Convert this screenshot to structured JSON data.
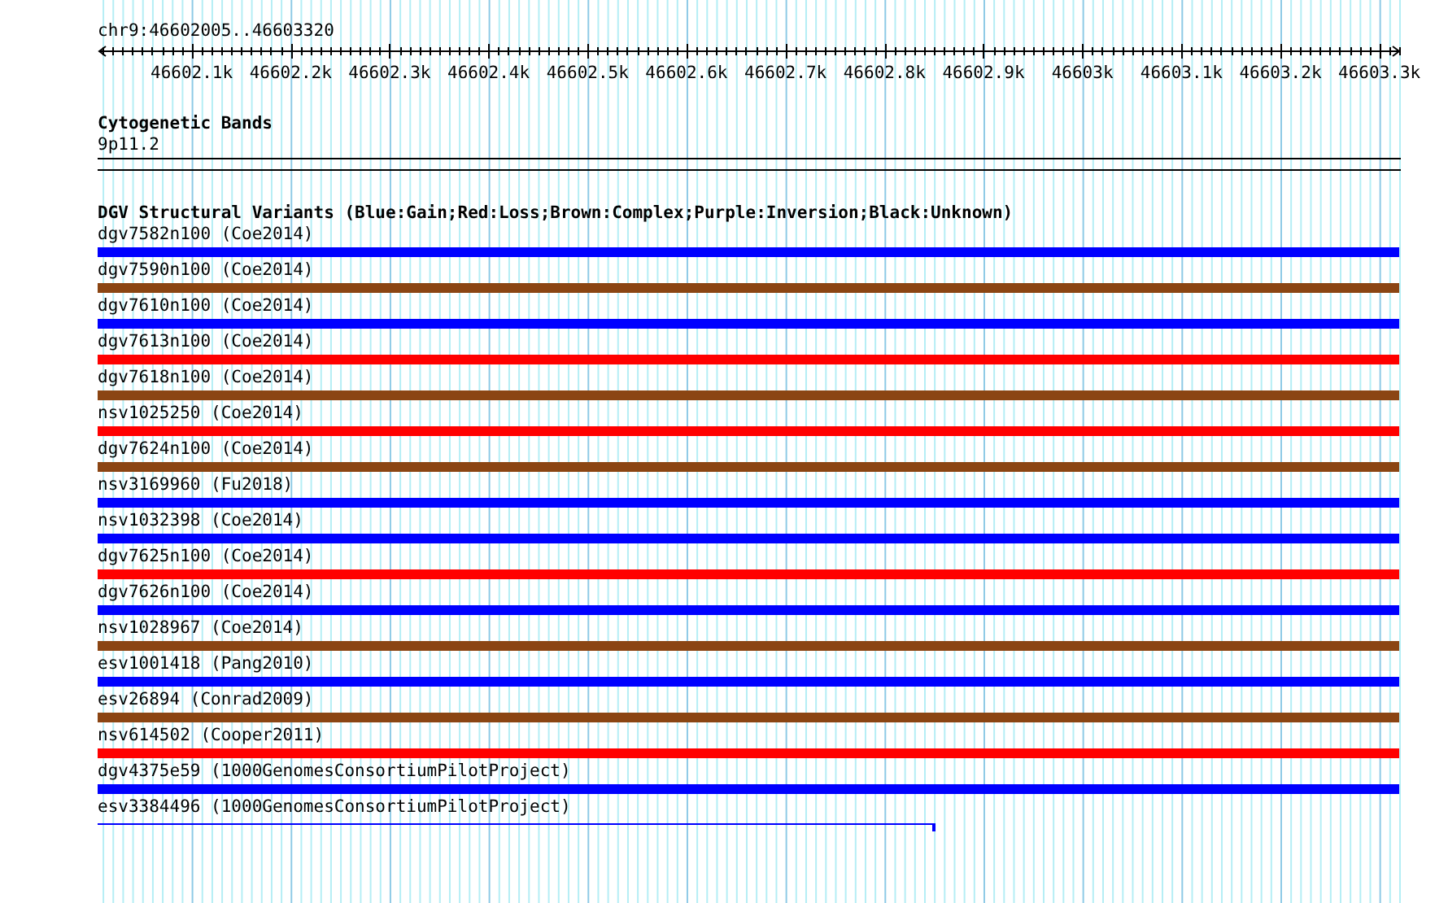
{
  "ruler": {
    "title": "chr9:46602005..46603320",
    "ticks": [
      "46602.1k",
      "46602.2k",
      "46602.3k",
      "46602.4k",
      "46602.5k",
      "46602.6k",
      "46602.7k",
      "46602.8k",
      "46602.9k",
      "46603k",
      "46603.1k",
      "46603.2k",
      "46603.3k"
    ]
  },
  "cytoband_track": {
    "title": "Cytogenetic Bands",
    "bands": [
      "9p11.2"
    ]
  },
  "variants_track": {
    "title": "DGV Structural Variants (Blue:Gain;Red:Loss;Brown:Complex;Purple:Inversion;Black:Unknown)",
    "features": [
      {
        "label": "dgv7582n100 (Coe2014)",
        "kind": "bar",
        "color": "#0000ff"
      },
      {
        "label": "dgv7590n100 (Coe2014)",
        "kind": "bar",
        "color": "#8b4513"
      },
      {
        "label": "dgv7610n100 (Coe2014)",
        "kind": "bar",
        "color": "#0000ff"
      },
      {
        "label": "dgv7613n100 (Coe2014)",
        "kind": "bar",
        "color": "#ff0000"
      },
      {
        "label": "dgv7618n100 (Coe2014)",
        "kind": "bar",
        "color": "#8b4513"
      },
      {
        "label": "nsv1025250 (Coe2014)",
        "kind": "bar",
        "color": "#ff0000"
      },
      {
        "label": "dgv7624n100 (Coe2014)",
        "kind": "bar",
        "color": "#8b4513"
      },
      {
        "label": "nsv3169960 (Fu2018)",
        "kind": "bar",
        "color": "#0000ff"
      },
      {
        "label": "nsv1032398 (Coe2014)",
        "kind": "bar",
        "color": "#0000ff"
      },
      {
        "label": "dgv7625n100 (Coe2014)",
        "kind": "bar",
        "color": "#ff0000"
      },
      {
        "label": "dgv7626n100 (Coe2014)",
        "kind": "bar",
        "color": "#0000ff"
      },
      {
        "label": "nsv1028967 (Coe2014)",
        "kind": "bar",
        "color": "#8b4513"
      },
      {
        "label": "esv1001418 (Pang2010)",
        "kind": "bar",
        "color": "#0000ff"
      },
      {
        "label": "esv26894 (Conrad2009)",
        "kind": "bar",
        "color": "#8b4513"
      },
      {
        "label": "nsv614502 (Cooper2011)",
        "kind": "bar",
        "color": "#ff0000"
      },
      {
        "label": "dgv4375e59 (1000GenomesConsortiumPilotProject)",
        "kind": "bar",
        "color": "#0000ff"
      },
      {
        "label": "esv3384496 (1000GenomesConsortiumPilotProject)",
        "kind": "line",
        "color": "#0000ff"
      }
    ]
  }
}
